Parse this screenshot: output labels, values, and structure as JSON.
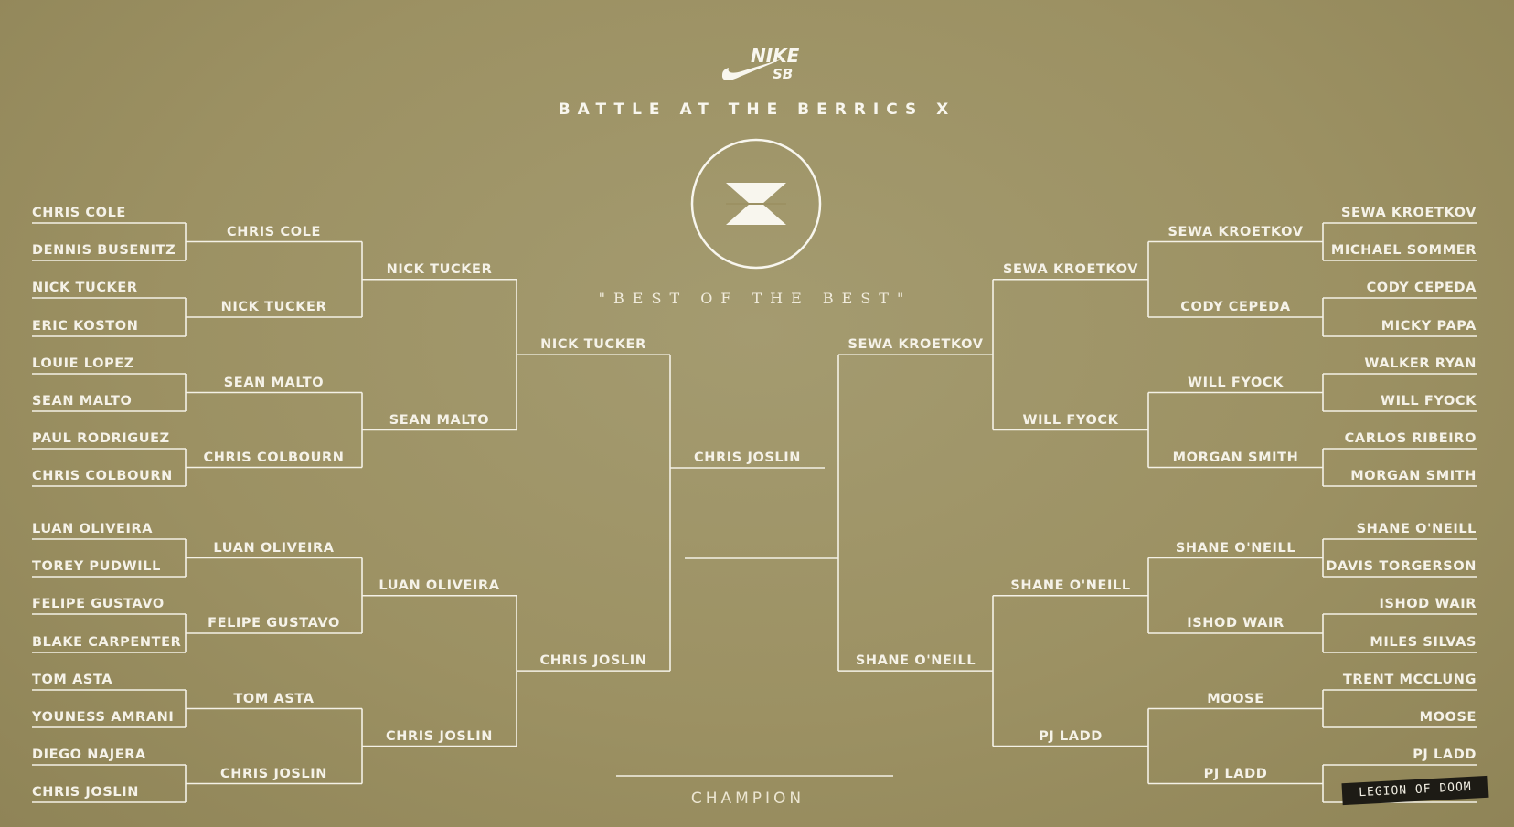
{
  "header": {
    "brand": "NIKE SB",
    "event_title": "BATTLE AT THE BERRICS X",
    "emblem": "X",
    "tagline": "\"BEST OF THE BEST\""
  },
  "champion_label": "CHAMPION",
  "team_tag": "LEGION OF DOOM",
  "colors": {
    "background": "#9c9163",
    "lines": "#f4f1e6"
  },
  "bracket": {
    "left": {
      "round1": [
        "CHRIS COLE",
        "DENNIS BUSENITZ",
        "NICK TUCKER",
        "ERIC KOSTON",
        "LOUIE LOPEZ",
        "SEAN MALTO",
        "PAUL RODRIGUEZ",
        "CHRIS COLBOURN",
        "LUAN OLIVEIRA",
        "TOREY PUDWILL",
        "FELIPE GUSTAVO",
        "BLAKE CARPENTER",
        "TOM ASTA",
        "YOUNESS AMRANI",
        "DIEGO NAJERA",
        "CHRIS JOSLIN"
      ],
      "round2": [
        "CHRIS COLE",
        "NICK TUCKER",
        "SEAN MALTO",
        "CHRIS COLBOURN",
        "LUAN OLIVEIRA",
        "FELIPE GUSTAVO",
        "TOM ASTA",
        "CHRIS JOSLIN"
      ],
      "round3": [
        "NICK TUCKER",
        "SEAN MALTO",
        "LUAN OLIVEIRA",
        "CHRIS JOSLIN"
      ],
      "round4": [
        "NICK TUCKER",
        "CHRIS JOSLIN"
      ],
      "finalist": "CHRIS JOSLIN"
    },
    "right": {
      "round1": [
        "SEWA KROETKOV",
        "MICHAEL SOMMER",
        "CODY CEPEDA",
        "MICKY PAPA",
        "WALKER RYAN",
        "WILL FYOCK",
        "CARLOS RIBEIRO",
        "MORGAN SMITH",
        "SHANE O'NEILL",
        "DAVIS TORGERSON",
        "ISHOD WAIR",
        "MILES SILVAS",
        "TRENT McCLUNG",
        "MOOSE",
        "PJ LADD",
        ""
      ],
      "round2": [
        "SEWA KROETKOV",
        "CODY CEPEDA",
        "WILL FYOCK",
        "MORGAN SMITH",
        "SHANE O'NEILL",
        "ISHOD WAIR",
        "MOOSE",
        "PJ LADD"
      ],
      "round3": [
        "SEWA KROETKOV",
        "WILL FYOCK",
        "SHANE O'NEILL",
        "PJ LADD"
      ],
      "round4": [
        "SEWA KROETKOV",
        "SHANE O'NEILL"
      ],
      "finalist": ""
    }
  }
}
